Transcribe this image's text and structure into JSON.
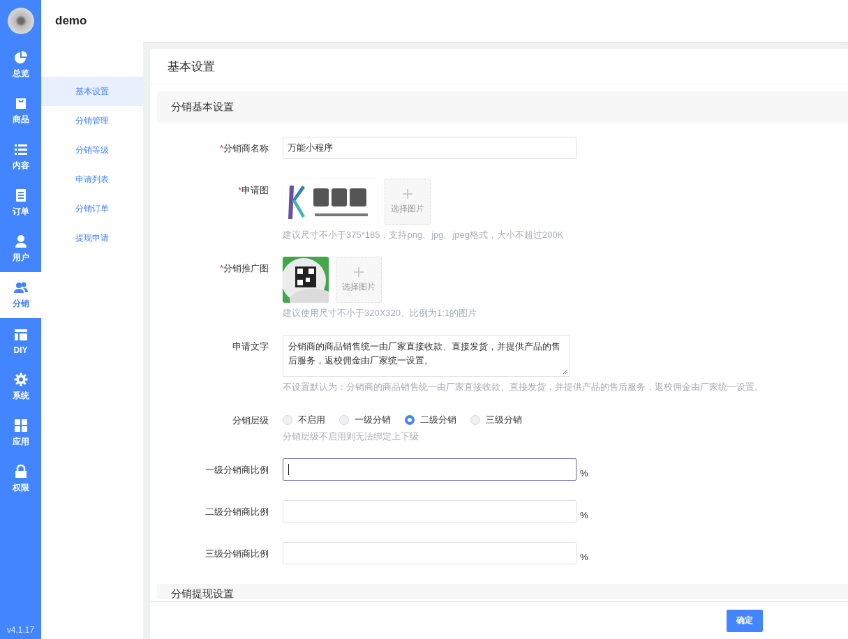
{
  "app": {
    "title": "demo",
    "version": "v4.1.17"
  },
  "nav": [
    {
      "label": "总览",
      "kind": "pie",
      "selected": false
    },
    {
      "label": "商品",
      "kind": "bag",
      "selected": false
    },
    {
      "label": "内容",
      "kind": "list",
      "selected": false
    },
    {
      "label": "订单",
      "kind": "doc",
      "selected": false
    },
    {
      "label": "用户",
      "kind": "user",
      "selected": false
    },
    {
      "label": "分销",
      "kind": "users",
      "selected": true
    },
    {
      "label": "DIY",
      "kind": "layout",
      "selected": false
    },
    {
      "label": "系统",
      "kind": "gear",
      "selected": false
    },
    {
      "label": "应用",
      "kind": "grid",
      "selected": false
    },
    {
      "label": "权限",
      "kind": "lock",
      "selected": false
    }
  ],
  "submenu": [
    {
      "label": "基本设置",
      "selected": true
    },
    {
      "label": "分销管理",
      "selected": false
    },
    {
      "label": "分销等级",
      "selected": false
    },
    {
      "label": "申请列表",
      "selected": false
    },
    {
      "label": "分销订单",
      "selected": false
    },
    {
      "label": "提现申请",
      "selected": false
    }
  ],
  "page": {
    "title": "基本设置"
  },
  "sections": [
    {
      "title": "分销基本设置"
    },
    {
      "title": "分销提现设置"
    }
  ],
  "form": [
    {
      "kind": "text",
      "label": "分销商名称",
      "required_mark": "*",
      "value": "万能小程序",
      "focused": false
    },
    {
      "label": "申请图",
      "required_mark": "*",
      "upload": "选择图片",
      "hint": "建议尺寸不小于375*185，支持png、jpg、jpeg格式，大小不超过200K"
    },
    {
      "label": "分销推广图",
      "required_mark": "*",
      "upload": "选择图片",
      "hint": "建议使用尺寸不小于320X320、比例为1:1的图片"
    },
    {
      "kind": "textarea",
      "label": "申请文字",
      "value": "分销商的商品销售统一由厂家直接收款、直接发货，并提供产品的售后服务，返校佣金由厂家统一设置。",
      "hint": "不设置默认为：分销商的商品销售统一由厂家直接收款、直接发货，并提供产品的售后服务，返校佣金由厂家统一设置。"
    },
    {
      "kind": "radio",
      "label": "分销层级",
      "options": [
        {
          "label": "不启用",
          "selected": false
        },
        {
          "label": "一级分销",
          "selected": false
        },
        {
          "label": "二级分销",
          "selected": true
        },
        {
          "label": "三级分销",
          "selected": false
        }
      ],
      "hint": "分销层级不启用则无法绑定上下级"
    },
    {
      "kind": "text",
      "label": "一级分销商比例",
      "unit": "%",
      "focused": true
    },
    {
      "kind": "text",
      "label": "二级分销商比例",
      "unit": "%",
      "focused": false
    },
    {
      "kind": "text",
      "label": "三级分销商比例",
      "unit": "%",
      "focused": false
    }
  ],
  "footer": {
    "button": "确定"
  }
}
